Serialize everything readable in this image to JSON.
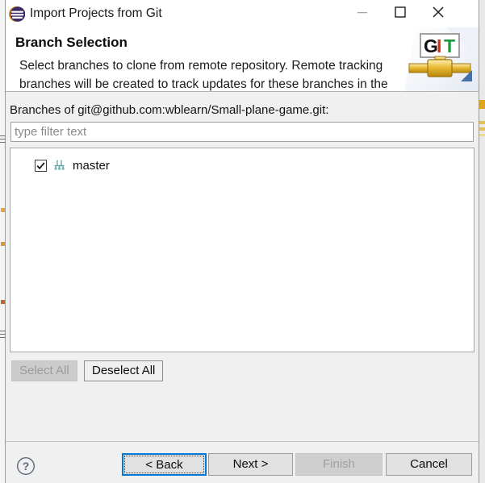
{
  "window": {
    "title": "Import Projects from Git",
    "app_icon": "eclipse-icon",
    "controls": {
      "minimize": "minimize-icon",
      "maximize": "maximize-icon",
      "close": "close-icon"
    }
  },
  "header": {
    "title": "Branch Selection",
    "description": "Select branches to clone from remote repository. Remote tracking branches will be created to track updates for these branches in the",
    "logo": "git-logo",
    "logo_text": {
      "g": "G",
      "i": "I",
      "t": "T"
    }
  },
  "main": {
    "branches_label": "Branches of git@github.com:wblearn/Small-plane-game.git:",
    "filter": {
      "value": "",
      "placeholder": "type filter text"
    },
    "branches": [
      {
        "name": "master",
        "checked": true,
        "icon": "git-branch-icon"
      }
    ],
    "select_all_label": "Select All",
    "select_all_enabled": false,
    "deselect_all_label": "Deselect All",
    "deselect_all_enabled": true
  },
  "footer": {
    "help_icon": "help-icon",
    "buttons": [
      {
        "label": "< Back",
        "enabled": true,
        "focused": true
      },
      {
        "label": "Next >",
        "enabled": true,
        "focused": false
      },
      {
        "label": "Finish",
        "enabled": false,
        "focused": false
      },
      {
        "label": "Cancel",
        "enabled": true,
        "focused": false
      }
    ]
  },
  "colors": {
    "accent": "#0078d7",
    "dialog_bg": "#f0f0f0",
    "header_bg": "#ffffff",
    "git_red": "#d42e12",
    "git_green": "#1a9a3c",
    "gold": "#dfa520"
  }
}
